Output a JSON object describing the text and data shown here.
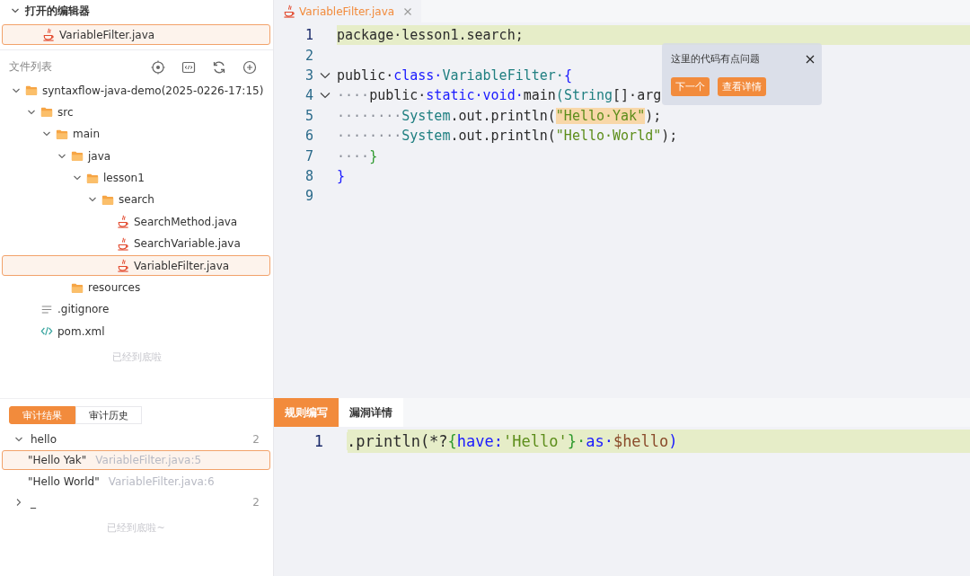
{
  "open_editors": {
    "title": "打开的编辑器",
    "expanded": true,
    "items": [
      {
        "label": "VariableFilter.java",
        "kind": "java",
        "selected": true
      }
    ]
  },
  "file_list": {
    "title": "文件列表",
    "tree": [
      {
        "label": "syntaxflow-java-demo(2025-0226-17:15)",
        "kind": "folder",
        "expanded": true,
        "selected": false,
        "children": [
          {
            "label": "src",
            "kind": "folder",
            "expanded": true,
            "selected": false,
            "children": [
              {
                "label": "main",
                "kind": "folder",
                "expanded": true,
                "selected": false,
                "children": [
                  {
                    "label": "java",
                    "kind": "folder",
                    "expanded": true,
                    "selected": false,
                    "children": [
                      {
                        "label": "lesson1",
                        "kind": "folder",
                        "expanded": true,
                        "selected": false,
                        "children": [
                          {
                            "label": "search",
                            "kind": "folder",
                            "expanded": true,
                            "selected": false,
                            "children": [
                              {
                                "label": "SearchMethod.java",
                                "kind": "java",
                                "selected": false
                              },
                              {
                                "label": "SearchVariable.java",
                                "kind": "java",
                                "selected": false
                              },
                              {
                                "label": "VariableFilter.java",
                                "kind": "java",
                                "selected": true
                              }
                            ]
                          }
                        ]
                      }
                    ]
                  },
                  {
                    "label": "resources",
                    "kind": "folder",
                    "selected": false
                  }
                ]
              }
            ]
          },
          {
            "label": ".gitignore",
            "kind": "text",
            "selected": false
          },
          {
            "label": "pom.xml",
            "kind": "xml",
            "selected": false
          }
        ]
      }
    ],
    "end_note": "已经到底啦"
  },
  "audit": {
    "tabs": [
      {
        "label": "审计结果",
        "selected": true
      },
      {
        "label": "审计历史",
        "selected": false
      }
    ],
    "groups": [
      {
        "name": "hello",
        "count": "2",
        "expanded": true,
        "items": [
          {
            "value": "\"Hello Yak\"",
            "location": "VariableFilter.java:5",
            "selected": true
          },
          {
            "value": "\"Hello World\"",
            "location": "VariableFilter.java:6",
            "selected": false
          }
        ]
      },
      {
        "name": "_",
        "count": "2",
        "expanded": false
      }
    ],
    "end_note": "已经到底啦~"
  },
  "editor": {
    "tabs": [
      {
        "label": "VariableFilter.java",
        "selected": true
      }
    ],
    "lines": [
      {
        "number": "1",
        "current": true,
        "foldable": false,
        "tokens": [
          {
            "text": "package·lesson1.search;",
            "kind": "plain"
          }
        ]
      },
      {
        "number": "2",
        "current": false,
        "foldable": false
      },
      {
        "number": "3",
        "current": false,
        "foldable": true,
        "tokens": [
          {
            "text": "public·",
            "kind": "plain"
          },
          {
            "text": "class·",
            "kind": "kw"
          },
          {
            "text": "VariableFilter·",
            "kind": "type"
          },
          {
            "text": "{",
            "kind": "brace"
          }
        ]
      },
      {
        "number": "4",
        "current": false,
        "foldable": true,
        "tokens": [
          {
            "text": "····",
            "kind": "ws"
          },
          {
            "text": "public·",
            "kind": "plain"
          },
          {
            "text": "static·void·",
            "kind": "kw"
          },
          {
            "text": "main",
            "kind": "plain"
          },
          {
            "text": "(",
            "kind": "paren"
          },
          {
            "text": "String",
            "kind": "type"
          },
          {
            "text": "[]·arg",
            "kind": "plain"
          }
        ]
      },
      {
        "number": "5",
        "current": false,
        "foldable": false,
        "tokens": [
          {
            "text": "········",
            "kind": "ws"
          },
          {
            "text": "System",
            "kind": "type"
          },
          {
            "text": ".out.println(",
            "kind": "plain"
          },
          {
            "text": "\"Hello·Yak\"",
            "kind": "match"
          },
          {
            "text": ");",
            "kind": "plain"
          }
        ]
      },
      {
        "number": "6",
        "current": false,
        "foldable": false,
        "tokens": [
          {
            "text": "········",
            "kind": "ws"
          },
          {
            "text": "System",
            "kind": "type"
          },
          {
            "text": ".out.println(",
            "kind": "plain"
          },
          {
            "text": "\"Hello·World\"",
            "kind": "str"
          },
          {
            "text": ");",
            "kind": "plain"
          }
        ]
      },
      {
        "number": "7",
        "current": false,
        "foldable": false,
        "tokens": [
          {
            "text": "····",
            "kind": "ws"
          },
          {
            "text": "}",
            "kind": "brace2"
          }
        ]
      },
      {
        "number": "8",
        "current": false,
        "foldable": false,
        "tokens": [
          {
            "text": "}",
            "kind": "brace"
          }
        ]
      },
      {
        "number": "9",
        "current": false,
        "foldable": false
      }
    ]
  },
  "hint_popup": {
    "message": "这里的代码有点问题",
    "buttons": [
      "下一个",
      "查看详情"
    ]
  },
  "rule_panel": {
    "tabs": [
      {
        "label": "规则编写",
        "selected": true
      },
      {
        "label": "漏洞详情",
        "selected": false
      }
    ],
    "lines": [
      {
        "number": "1",
        "current": true,
        "foldable": false,
        "tokens": [
          {
            "text": ".println(*?",
            "kind": "plain"
          },
          {
            "text": "{",
            "kind": "brace2"
          },
          {
            "text": "have:",
            "kind": "kw"
          },
          {
            "text": "'Hello'",
            "kind": "str"
          },
          {
            "text": "}·",
            "kind": "brace2"
          },
          {
            "text": "as·",
            "kind": "kw"
          },
          {
            "text": "$hello",
            "kind": "var"
          },
          {
            "text": ")",
            "kind": "brace"
          }
        ]
      }
    ]
  }
}
